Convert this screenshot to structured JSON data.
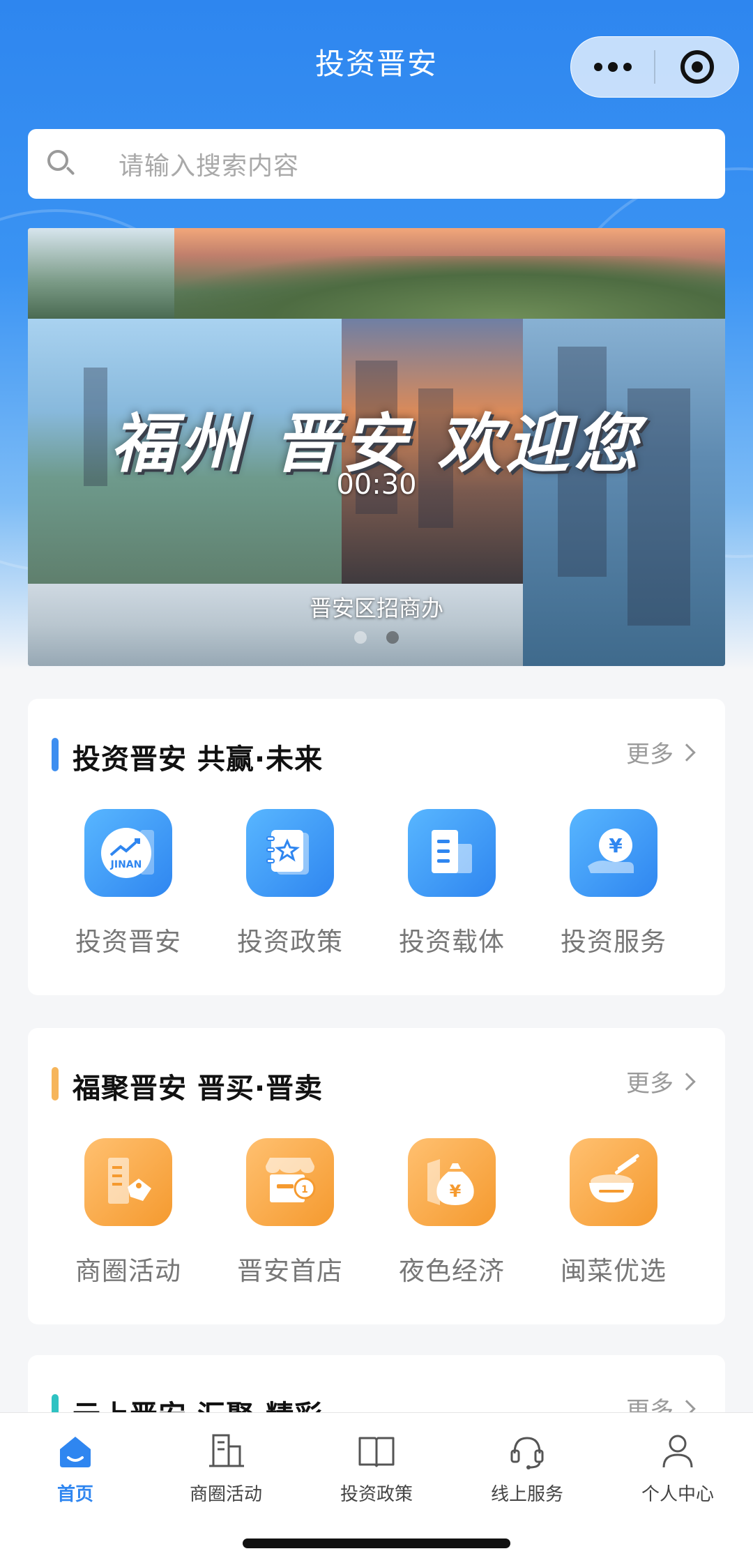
{
  "header": {
    "title": "投资晋安",
    "menu_icon": "more-dots-icon",
    "close_icon": "target-close-icon"
  },
  "search": {
    "placeholder": "请输入搜索内容"
  },
  "banner": {
    "headline": "福州 晋安 欢迎您",
    "time": "00:30",
    "caption": "晋安区招商办",
    "slides": 2,
    "active_slide": 2
  },
  "sections": [
    {
      "title": "投资晋安 共赢·未来",
      "more": "更多",
      "accent": "#3d8ef0",
      "items": [
        {
          "label": "投资晋安",
          "icon": "jinan-growth-icon"
        },
        {
          "label": "投资政策",
          "icon": "policy-book-icon"
        },
        {
          "label": "投资载体",
          "icon": "building-doc-icon"
        },
        {
          "label": "投资服务",
          "icon": "yuan-hand-icon"
        }
      ]
    },
    {
      "title": "福聚晋安 晋买·晋卖",
      "more": "更多",
      "accent": "#f6b55a",
      "items": [
        {
          "label": "商圈活动",
          "icon": "building-tag-icon"
        },
        {
          "label": "晋安首店",
          "icon": "storefront-badge-icon"
        },
        {
          "label": "夜色经济",
          "icon": "moneybag-icon"
        },
        {
          "label": "闽菜优选",
          "icon": "bowl-chopsticks-icon"
        }
      ]
    },
    {
      "title": "云上晋安 汇聚·精彩",
      "more": "更多",
      "accent": "#2ec2c2"
    }
  ],
  "tabbar": {
    "active_color": "#2f86f0",
    "items": [
      {
        "label": "首页",
        "icon": "home-icon",
        "active": true
      },
      {
        "label": "商圈活动",
        "icon": "building-icon",
        "active": false
      },
      {
        "label": "投资政策",
        "icon": "book-icon",
        "active": false
      },
      {
        "label": "线上服务",
        "icon": "headset-icon",
        "active": false
      },
      {
        "label": "个人中心",
        "icon": "person-icon",
        "active": false
      }
    ]
  }
}
